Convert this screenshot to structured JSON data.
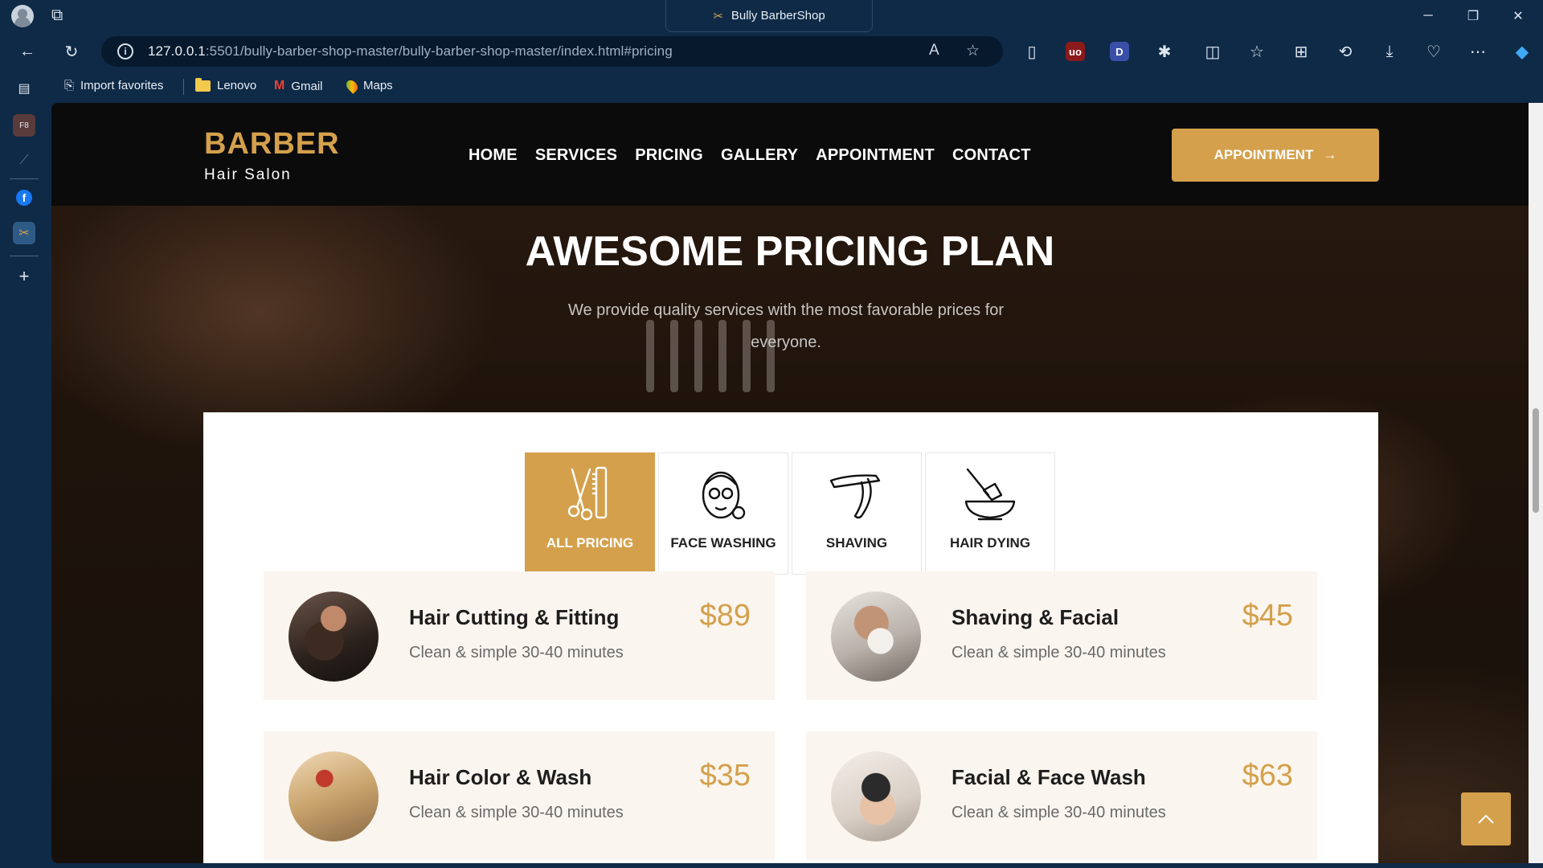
{
  "browser": {
    "tab_title": "Bully BarberShop",
    "url_host": "127.0.0.1",
    "url_rest": ":5501/bully-barber-shop-master/bully-barber-shop-master/index.html#pricing",
    "favorites": [
      {
        "label": "Import favorites",
        "icon": "import-icon"
      },
      {
        "label": "Lenovo",
        "icon": "folder-icon"
      },
      {
        "label": "Gmail",
        "icon": "gmail-icon"
      },
      {
        "label": "Maps",
        "icon": "maps-icon"
      }
    ],
    "ext_ublock": "uo",
    "ext_d": "D"
  },
  "site": {
    "brand": "BARBER",
    "brand_sub": "Hair Salon",
    "menu": [
      "HOME",
      "SERVICES",
      "PRICING",
      "GALLERY",
      "APPOINTMENT",
      "CONTACT"
    ],
    "cta_label": "APPOINTMENT",
    "cta_arrow": "→"
  },
  "pricing": {
    "title": "AWESOME PRICING PLAN",
    "subtitle": "We provide quality services with the most favorable prices for everyone.",
    "tabs": [
      {
        "label": "ALL PRICING",
        "icon": "scissors-comb-icon",
        "active": true
      },
      {
        "label": "FACE WASHING",
        "icon": "face-mask-icon",
        "active": false
      },
      {
        "label": "SHAVING",
        "icon": "razor-icon",
        "active": false
      },
      {
        "label": "HAIR DYING",
        "icon": "dye-brush-icon",
        "active": false
      }
    ],
    "items": [
      {
        "name": "Hair Cutting & Fitting",
        "desc": "Clean & simple 30-40 minutes",
        "price": "$89"
      },
      {
        "name": "Shaving & Facial",
        "desc": "Clean & simple 30-40 minutes",
        "price": "$45"
      },
      {
        "name": "Hair Color & Wash",
        "desc": "Clean & simple 30-40 minutes",
        "price": "$35"
      },
      {
        "name": "Facial & Face Wash",
        "desc": "Clean & simple 30-40 minutes",
        "price": "$63"
      }
    ]
  },
  "colors": {
    "accent": "#d4a04c",
    "chrome": "#0e2a47",
    "card_bg": "#faf5ee"
  }
}
